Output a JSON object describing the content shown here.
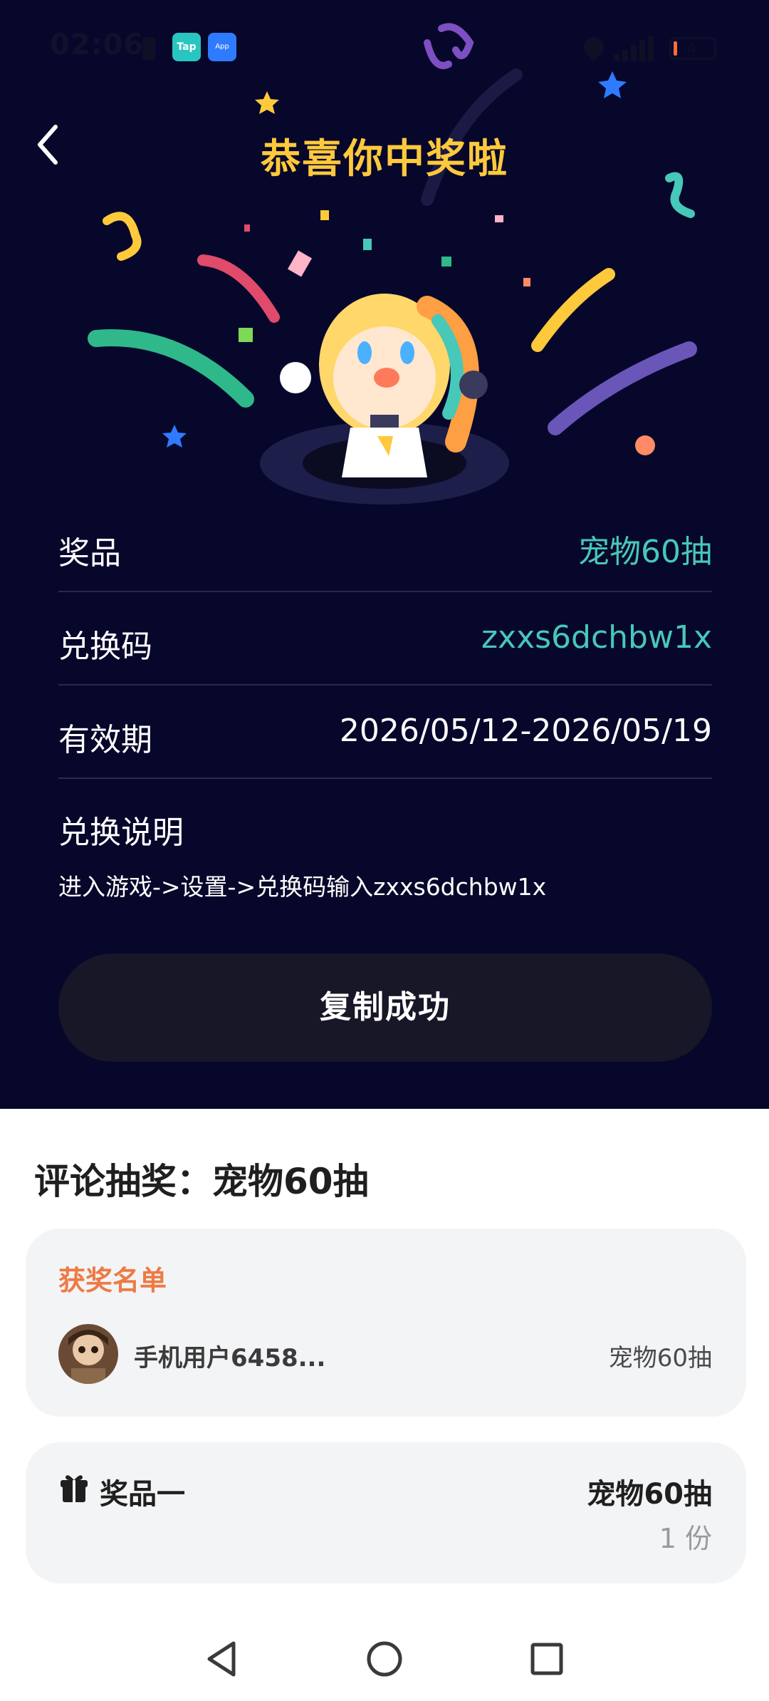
{
  "status_bar": {
    "time": "02:06",
    "app_icons": [
      "Tap",
      "App Market"
    ],
    "icons": [
      "sim-icon",
      "location-icon",
      "signal-icon",
      "battery-icon"
    ],
    "battery": "4"
  },
  "header": {
    "title": "恭喜你中奖啦",
    "back_icon": "chevron-left-icon"
  },
  "prize_info": {
    "rows": [
      {
        "label": "奖品",
        "value": "宠物60抽"
      },
      {
        "label": "兑换码",
        "value": "zxxs6dchbw1x"
      },
      {
        "label": "有效期",
        "value": "2026/05/12-2026/05/19"
      }
    ],
    "instructions_title": "兑换说明",
    "instructions_text": "进入游戏->设置->兑换码输入zxxs6dchbw1x"
  },
  "copy_button": "复制成功",
  "lottery": {
    "title": "评论抽奖：宠物60抽",
    "winners_title": "获奖名单",
    "winners": [
      {
        "name": "手机用户6458...",
        "prize": "宠物60抽"
      }
    ],
    "prize_label": "奖品一",
    "prize_name": "宠物60抽",
    "prize_count": "1 份"
  },
  "colors": {
    "hero_bg": "#07072b",
    "title": "#ffc93c",
    "teal": "#47c8b8",
    "button_bg": "#171728",
    "winner_title": "#ee7a44",
    "card_bg": "#f3f4f6"
  },
  "nav_icons": [
    "back-triangle-icon",
    "home-circle-icon",
    "recents-square-icon"
  ]
}
